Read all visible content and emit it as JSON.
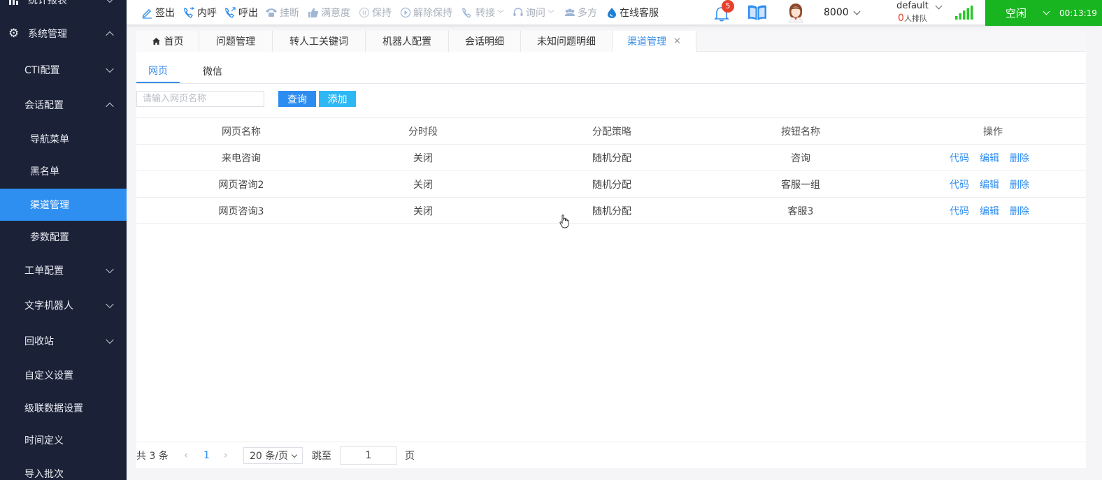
{
  "sidebar": {
    "items": [
      {
        "label": "统计报表"
      },
      {
        "label": "系统管理"
      },
      {
        "label": "CTI配置"
      },
      {
        "label": "会话配置"
      },
      {
        "label": "导航菜单"
      },
      {
        "label": "黑名单"
      },
      {
        "label": "渠道管理"
      },
      {
        "label": "参数配置"
      },
      {
        "label": "工单配置"
      },
      {
        "label": "文字机器人"
      },
      {
        "label": "回收站"
      },
      {
        "label": "自定义设置"
      },
      {
        "label": "级联数据设置"
      },
      {
        "label": "时间定义"
      },
      {
        "label": "导入批次"
      }
    ]
  },
  "toolbar": {
    "sign_out": "签出",
    "internal_call": "内呼",
    "outbound_call": "呼出",
    "hang_up": "挂断",
    "satisfaction": "满意度",
    "hold": "保持",
    "unhold": "解除保持",
    "transfer": "转接",
    "consult": "询问",
    "conference": "多方",
    "online_service": "在线客服",
    "notification_count": "5",
    "extension": "8000",
    "queue_name": "default",
    "queue_count": "0",
    "queue_suffix": "人排队",
    "status": "空闲",
    "timer": "00:13:19"
  },
  "tabs": [
    {
      "label": "首页"
    },
    {
      "label": "问题管理"
    },
    {
      "label": "转人工关键词"
    },
    {
      "label": "机器人配置"
    },
    {
      "label": "会话明细"
    },
    {
      "label": "未知问题明细"
    },
    {
      "label": "渠道管理"
    }
  ],
  "subtabs": [
    {
      "label": "网页"
    },
    {
      "label": "微信"
    }
  ],
  "search": {
    "placeholder": "请输入网页名称",
    "query_label": "查询",
    "add_label": "添加"
  },
  "table": {
    "headers": [
      "网页名称",
      "分时段",
      "分配策略",
      "按钮名称",
      "操作"
    ],
    "rows": [
      {
        "name": "来电咨询",
        "period": "关闭",
        "strategy": "随机分配",
        "button": "咨询"
      },
      {
        "name": "网页咨询2",
        "period": "关闭",
        "strategy": "随机分配",
        "button": "客服一组"
      },
      {
        "name": "网页咨询3",
        "period": "关闭",
        "strategy": "随机分配",
        "button": "客服3"
      }
    ],
    "ops": {
      "code": "代码",
      "edit": "编辑",
      "delete": "删除"
    }
  },
  "pager": {
    "total": "共 3 条",
    "current": "1",
    "page_size": "20 条/页",
    "jump_to": "跳至",
    "jump_value": "1",
    "page_unit": "页"
  },
  "colors": {
    "sidebar_bg": "#1b2238",
    "sidebar_active": "#2f8ff0",
    "status_green": "#19b520",
    "link_blue": "#2d8cf0"
  }
}
